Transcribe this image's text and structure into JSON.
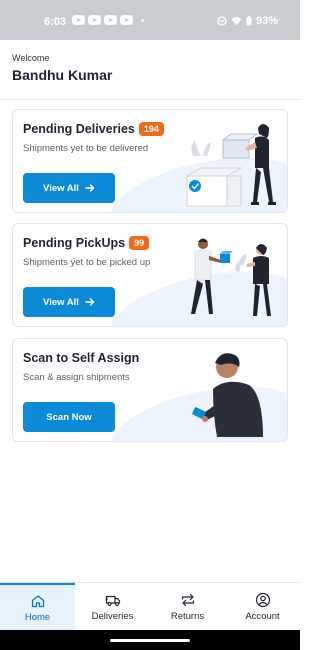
{
  "status_bar": {
    "time": "6:03",
    "battery": "93%"
  },
  "header": {
    "welcome": "Welcome",
    "user_name": "Bandhu Kumar"
  },
  "cards": [
    {
      "title": "Pending Deliveries",
      "badge": "194",
      "subtitle": "Shipments yet to be delivered",
      "button": "View All"
    },
    {
      "title": "Pending PickUps",
      "badge": "99",
      "subtitle": "Shipments yet to be picked up",
      "button": "View All"
    },
    {
      "title": "Scan to Self Assign",
      "subtitle": "Scan & assign shipments",
      "button": "Scan Now"
    }
  ],
  "nav": [
    {
      "label": "Home",
      "icon": "home-icon",
      "active": true
    },
    {
      "label": "Deliveries",
      "icon": "truck-icon",
      "active": false
    },
    {
      "label": "Returns",
      "icon": "returns-icon",
      "active": false
    },
    {
      "label": "Account",
      "icon": "account-icon",
      "active": false
    }
  ],
  "colors": {
    "accent": "#0b8ad8",
    "badge": "#f06a1a",
    "active_nav_bg": "#e7f3fc"
  }
}
